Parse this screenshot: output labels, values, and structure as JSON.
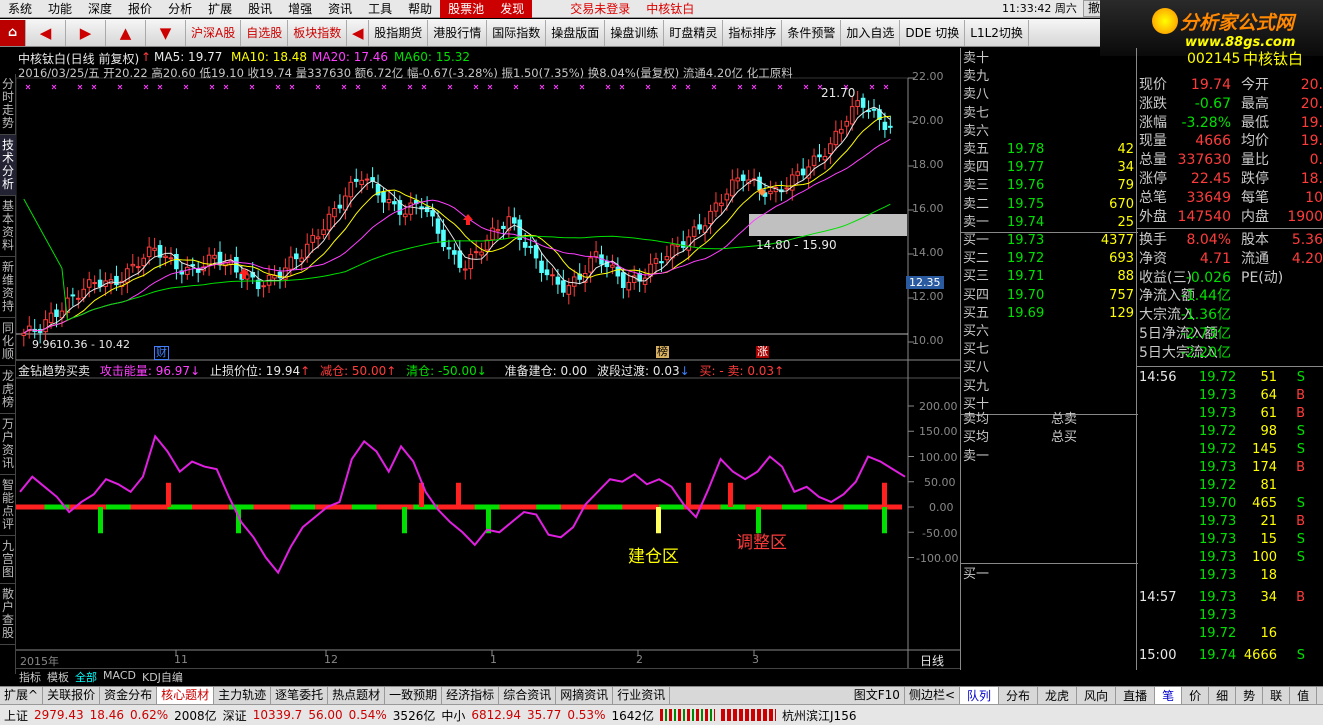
{
  "menu": {
    "items": [
      "系统",
      "功能",
      "深度",
      "报价",
      "分析",
      "扩展",
      "股讯",
      "增强",
      "资讯",
      "工具",
      "帮助"
    ],
    "stock_pool": "股票池",
    "discover": "发现",
    "status": "交易未登录",
    "stock": "中核钛白",
    "time": "11:33:42 周六",
    "cancel": "撤单"
  },
  "toolbar": {
    "home": "⌂",
    "buttons": [
      "沪深A股",
      "自选股",
      "板块指数",
      "股指期货",
      "港股行情",
      "国际指数",
      "操盘版面",
      "操盘训练",
      "盯盘精灵",
      "指标排序",
      "条件预警",
      "加入自选",
      "DDE 切换",
      "L1L2切换"
    ]
  },
  "logo": {
    "title": "分析家公式网",
    "url": "www.88gs.com"
  },
  "leftnav": [
    "分时走势",
    "技术分析",
    "基本资料",
    "新维资持",
    "同化顺",
    "龙虎榜",
    "万户资讯",
    "智能点评",
    "九宫图",
    "散户查股"
  ],
  "chart": {
    "title": "中核钛白(日线 前复权)",
    "ma": [
      {
        "label": "MA5: 19.77",
        "color": "#e8e8e8"
      },
      {
        "label": "MA10: 18.48",
        "color": "#ffff00"
      },
      {
        "label": "MA20: 17.46",
        "color": "#ff40ff"
      },
      {
        "label": "MA60: 15.32",
        "color": "#00e000"
      }
    ],
    "info_line": "2016/03/25/五 开20.22 高20.60 低19.10 收19.74 量337630 额6.72亿 幅-0.67(-3.28%) 振1.50(7.35%) 换8.04%(量复权) 流通4.20亿 化工原料",
    "y_labels": [
      "22.00",
      "20.00",
      "18.00",
      "16.00",
      "14.00",
      "12.00",
      "10.00"
    ],
    "price_tag": "12.35",
    "ann_high": "21.70",
    "ann_range": "14.80 - 15.90",
    "ann_low": "9.96",
    "ann_low_range": "10.36 - 10.42",
    "markers": [
      "财",
      "榜",
      "涨"
    ],
    "ind_line": [
      {
        "t": "金钻趋势买卖",
        "c": "#e8e8e8"
      },
      {
        "t": "攻击能量: 96.97",
        "c": "#ff40ff"
      },
      {
        "t": "止损价位: 19.94",
        "c": "#e8e8e8"
      },
      {
        "t": "减仓: 50.00",
        "c": "#ff3c3c"
      },
      {
        "t": "清仓: -50.00",
        "c": "#00e000"
      },
      {
        "t": "准备建仓: 0.00",
        "c": "#e8e8e8"
      },
      {
        "t": "波段过渡: 0.03",
        "c": "#e8e8e8"
      },
      {
        "t": "买: -  卖: 0.03",
        "c": "#ff3c3c"
      }
    ],
    "ind_y": [
      "200.00",
      "150.00",
      "100.00",
      "50.00",
      "0.00",
      "-50.00",
      "-100.00"
    ],
    "zone_build": "建仓区",
    "zone_adjust": "调整区",
    "x_labels": [
      "2015年",
      "11",
      "12",
      "1",
      "2",
      "3"
    ],
    "period": "日线",
    "tabs": [
      "指标",
      "模板",
      "全部",
      "MACD",
      "KDJ自编"
    ]
  },
  "quote": {
    "sell": [
      [
        "卖十",
        "",
        ""
      ],
      [
        "卖九",
        "",
        ""
      ],
      [
        "卖八",
        "",
        ""
      ],
      [
        "卖七",
        "",
        ""
      ],
      [
        "卖六",
        "",
        ""
      ],
      [
        "卖五",
        "19.78",
        "42"
      ],
      [
        "卖四",
        "19.77",
        "34"
      ],
      [
        "卖三",
        "19.76",
        "79"
      ],
      [
        "卖二",
        "19.75",
        "670"
      ],
      [
        "卖一",
        "19.74",
        "25"
      ]
    ],
    "buy": [
      [
        "买一",
        "19.73",
        "4377"
      ],
      [
        "买二",
        "19.72",
        "693"
      ],
      [
        "买三",
        "19.71",
        "88"
      ],
      [
        "买四",
        "19.70",
        "757"
      ],
      [
        "买五",
        "19.69",
        "129"
      ],
      [
        "买六",
        "",
        ""
      ],
      [
        "买七",
        "",
        ""
      ],
      [
        "买八",
        "",
        ""
      ],
      [
        "买九",
        "",
        ""
      ],
      [
        "买十",
        "",
        ""
      ]
    ],
    "avg_sell": "卖均",
    "total_sell": "总卖",
    "avg_buy": "买均",
    "total_buy": "总买",
    "sell1b": "卖一",
    "buy1b": "买一"
  },
  "info": {
    "code": "002145",
    "name": "中核钛白",
    "rows": [
      [
        "现价",
        "19.74",
        "今开",
        "20."
      ],
      [
        "涨跌",
        "-0.67",
        "最高",
        "20."
      ],
      [
        "涨幅",
        "-3.28%",
        "最低",
        "19."
      ],
      [
        "现量",
        "4666",
        "均价",
        "19."
      ],
      [
        "总量",
        "337630",
        "量比",
        "0."
      ],
      [
        "涨停",
        "22.45",
        "跌停",
        "18."
      ],
      [
        "总笔",
        "33649",
        "每笔",
        "10"
      ],
      [
        "外盘",
        "147540",
        "内盘",
        "1900"
      ]
    ],
    "rows2": [
      [
        "换手",
        "8.04%",
        "股本",
        "5.36"
      ],
      [
        "净资",
        "4.71",
        "流通",
        "4.20"
      ],
      [
        "收益(三)",
        "-0.026",
        "PE(动)",
        ""
      ],
      [
        "净流入额",
        "-1.44亿",
        "",
        ""
      ],
      [
        "大宗流入",
        "-1.36亿",
        "",
        ""
      ],
      [
        "5日净流入额",
        "-2.73亿",
        "",
        ""
      ],
      [
        "5日大宗流入",
        "-2.20亿",
        "",
        ""
      ]
    ],
    "ticks": [
      [
        "14:56",
        "19.72",
        "51",
        "S"
      ],
      [
        "",
        "19.73",
        "64",
        "B"
      ],
      [
        "",
        "19.73",
        "61",
        "B"
      ],
      [
        "",
        "19.72",
        "98",
        "S"
      ],
      [
        "",
        "19.72",
        "145",
        "S"
      ],
      [
        "",
        "19.73",
        "174",
        "B"
      ],
      [
        "",
        "19.72",
        "81",
        ""
      ],
      [
        "",
        "19.70",
        "465",
        "S"
      ],
      [
        "",
        "19.73",
        "21",
        "B"
      ],
      [
        "",
        "19.73",
        "15",
        "S"
      ],
      [
        "",
        "19.73",
        "100",
        "S"
      ],
      [
        "",
        "19.73",
        "18",
        ""
      ],
      [
        "14:57",
        "19.73",
        "34",
        "B"
      ],
      [
        "",
        "19.73",
        "",
        ""
      ],
      [
        "",
        "19.72",
        "16",
        ""
      ],
      [
        "15:00",
        "19.74",
        "4666",
        "S"
      ]
    ]
  },
  "bottombar": [
    "扩展^",
    "关联报价",
    "资金分布",
    "核心题材",
    "主力轨迹",
    "逐笔委托",
    "热点题材",
    "一致预期",
    "经济指标",
    "综合资讯",
    "网摘资讯",
    "行业资讯"
  ],
  "bottom_right": [
    "图文F10",
    "侧边栏<"
  ],
  "righttabs": [
    "队列",
    "分布",
    "龙虎",
    "风向",
    "直播",
    "笔",
    "价",
    "细",
    "势",
    "联",
    "值"
  ],
  "status": {
    "sh": "上证",
    "sh_v": "2979.43",
    "sh_c": "18.46",
    "sh_p": "0.62%",
    "sh_a": "2008亿",
    "sz": "深证",
    "sz_v": "10339.7",
    "sz_c": "56.00",
    "sz_p": "0.54%",
    "sz_a": "3526亿",
    "zx": "中小",
    "zx_v": "6812.94",
    "zx_c": "35.77",
    "zx_p": "0.53%",
    "zx_a": "1642亿",
    "loc": "杭州滨江J156"
  }
}
